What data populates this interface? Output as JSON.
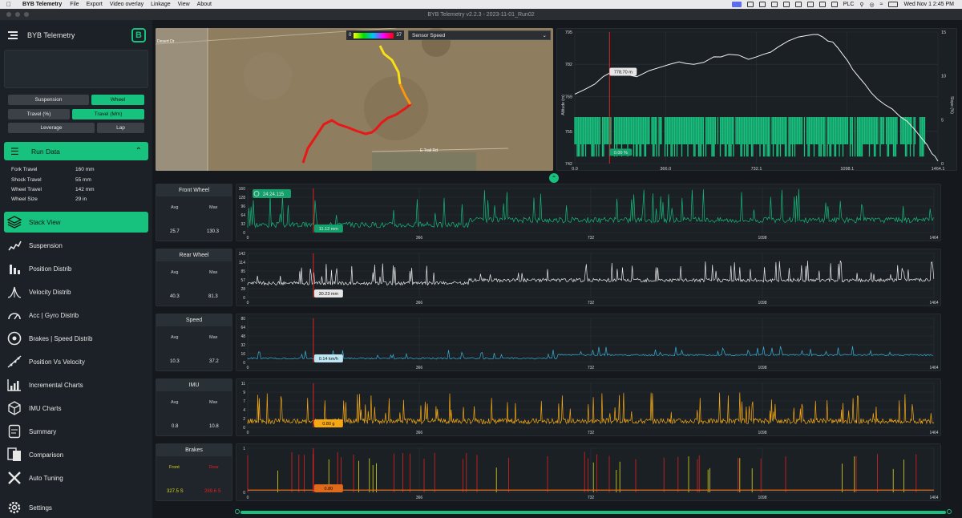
{
  "menubar": {
    "app_name": "BYB Telemetry",
    "items": [
      "File",
      "Export",
      "Video overlay",
      "Linkage",
      "View",
      "About"
    ],
    "status": {
      "plc": "PLC",
      "clock": "Wed Nov 1  2:45 PM"
    }
  },
  "window": {
    "title": "BYB Telemetry v2.2.3 - 2023-11-01_Run02"
  },
  "sidebar": {
    "title": "BYB Telemetry",
    "logo_letter": "B",
    "toggles": {
      "suspension": "Suspension",
      "wheel": "Wheel",
      "travel_pct": "Travel (%)",
      "travel_mm": "Travel (Mm)",
      "leverage": "Leverage",
      "lap": "Lap"
    },
    "run_data": {
      "label": "Run Data",
      "specs": [
        {
          "k": "Fork Travel",
          "v": "160 mm"
        },
        {
          "k": "Shock Travel",
          "v": "55 mm"
        },
        {
          "k": "Wheel Travel",
          "v": "142 mm"
        },
        {
          "k": "Wheel Size",
          "v": "29 in"
        }
      ]
    },
    "nav": [
      {
        "label": "Stack View",
        "icon": "stack-icon",
        "active": true
      },
      {
        "label": "Suspension",
        "icon": "spring-icon"
      },
      {
        "label": "Position Distrib",
        "icon": "bar-chart-icon"
      },
      {
        "label": "Velocity Distrib",
        "icon": "velocity-distribution-icon"
      },
      {
        "label": "Acc | Gyro Distrib",
        "icon": "gauge-icon"
      },
      {
        "label": "Brakes | Speed Distrib",
        "icon": "brake-disc-icon"
      },
      {
        "label": "Position Vs Velocity",
        "icon": "scatter-icon"
      },
      {
        "label": "Incremental Charts",
        "icon": "incremental-chart-icon"
      },
      {
        "label": "IMU Charts",
        "icon": "cube-icon"
      },
      {
        "label": "Summary",
        "icon": "summary-icon"
      },
      {
        "label": "Comparison",
        "icon": "comparison-icon"
      },
      {
        "label": "Auto Tuning",
        "icon": "wrench-icon"
      },
      {
        "label": "Settings",
        "icon": "gear-icon"
      }
    ]
  },
  "map": {
    "scale_min": "0",
    "scale_max": "37",
    "sensor_select": "Sensor Speed",
    "road_labels": [
      "Desert Dr",
      "E Trail Rd"
    ]
  },
  "colors": {
    "accent": "#17c27f",
    "front": "#16b87a",
    "rear": "#e8e8e8",
    "speed": "#3ab0d8",
    "imu": "#f5a814",
    "brake_front": "#d8d81c",
    "brake_rear": "#e02020",
    "cursor": "#e02020"
  },
  "chart_data": [
    {
      "type": "line",
      "name": "elevation",
      "x_ticks": [
        "0.0",
        "366.0",
        "732.1",
        "1098.1",
        "1464.1"
      ],
      "y_ticks_left": [
        "795",
        "782",
        "769",
        "755",
        "742"
      ],
      "y_ticks_right": [
        "15",
        "10",
        "5",
        "0"
      ],
      "ylabel": "Altitude (m)",
      "ylabel_right": "Slope (%)",
      "xlim": [
        0,
        1464.1
      ],
      "ylim": [
        742,
        795
      ],
      "ylim_right": [
        0,
        15
      ],
      "cursor_x": 140,
      "cursor_labels": [
        "778.70 m",
        "0.00 %"
      ],
      "series": [
        {
          "name": "altitude",
          "x": [
            0,
            80,
            150,
            250,
            350,
            420,
            480,
            560,
            620,
            700,
            760,
            820,
            900,
            960,
            1000,
            1040,
            1080,
            1120,
            1170,
            1220,
            1280,
            1340,
            1400,
            1440,
            1464
          ],
          "values": [
            770,
            774,
            779,
            777,
            781,
            783,
            782,
            785,
            786,
            784,
            786,
            789,
            793,
            794,
            793,
            791,
            786,
            780,
            774,
            768,
            764,
            759,
            752,
            746,
            743
          ]
        }
      ]
    },
    {
      "type": "line",
      "name": "front-wheel",
      "title": "Front Wheel",
      "stats": {
        "avg_label": "Avg",
        "max_label": "Max",
        "avg": "25.7",
        "max": "130.3"
      },
      "x_ticks": [
        "0",
        "366",
        "732",
        "1098",
        "1464"
      ],
      "y_ticks": [
        "160",
        "128",
        "96",
        "64",
        "32",
        "0"
      ],
      "ylim": [
        0,
        160
      ],
      "xlim": [
        0,
        1464
      ],
      "cursor_x": 140,
      "cursor_label": "11.12 mm",
      "timer": "24:24.115"
    },
    {
      "type": "line",
      "name": "rear-wheel",
      "title": "Rear Wheel",
      "stats": {
        "avg_label": "Avg",
        "max_label": "Max",
        "avg": "40.3",
        "max": "81.3"
      },
      "x_ticks": [
        "0",
        "366",
        "732",
        "1098",
        "1464"
      ],
      "y_ticks": [
        "142",
        "114",
        "85",
        "57",
        "28",
        "0"
      ],
      "ylim": [
        0,
        142
      ],
      "xlim": [
        0,
        1464
      ],
      "cursor_x": 140,
      "cursor_label": "30.23 mm"
    },
    {
      "type": "line",
      "name": "speed",
      "title": "Speed",
      "stats": {
        "avg_label": "Avg",
        "max_label": "Max",
        "avg": "10.3",
        "max": "37.2"
      },
      "x_ticks": [
        "0",
        "366",
        "732",
        "1098",
        "1464"
      ],
      "y_ticks": [
        "80",
        "64",
        "48",
        "32",
        "16",
        "0"
      ],
      "ylim": [
        0,
        80
      ],
      "xlim": [
        0,
        1464
      ],
      "cursor_x": 140,
      "cursor_label": "0.14 km/h"
    },
    {
      "type": "line",
      "name": "imu",
      "title": "IMU",
      "stats": {
        "avg_label": "Avg",
        "max_label": "Max",
        "avg": "0.8",
        "max": "10.8"
      },
      "x_ticks": [
        "0",
        "366",
        "732",
        "1098",
        "1464"
      ],
      "y_ticks": [
        "11",
        "9",
        "7",
        "4",
        "2",
        "0"
      ],
      "ylim": [
        0,
        11
      ],
      "xlim": [
        0,
        1464
      ],
      "cursor_x": 140,
      "cursor_label": "0.80 g"
    },
    {
      "type": "line",
      "name": "brakes",
      "title": "Brakes",
      "stats": {
        "avg_label": "Front",
        "max_label": "Rear",
        "avg": "327.5 S",
        "max": "289.6 S"
      },
      "x_ticks": [
        "0",
        "366",
        "732",
        "1098",
        "1464"
      ],
      "y_ticks": [
        "1",
        "0"
      ],
      "ylim": [
        0,
        1
      ],
      "xlim": [
        0,
        1464
      ],
      "cursor_x": 140,
      "cursor_label": "0.80"
    }
  ]
}
